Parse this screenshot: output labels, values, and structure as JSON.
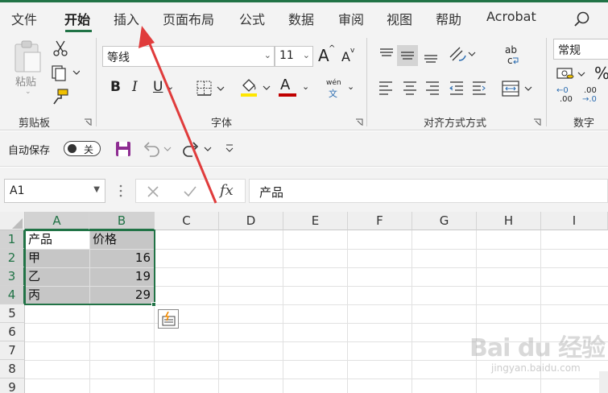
{
  "tabs": [
    {
      "label": "文件"
    },
    {
      "label": "开始",
      "active": true
    },
    {
      "label": "插入"
    },
    {
      "label": "页面布局"
    },
    {
      "label": "公式"
    },
    {
      "label": "数据"
    },
    {
      "label": "审阅"
    },
    {
      "label": "视图"
    },
    {
      "label": "帮助"
    },
    {
      "label": "Acrobat"
    }
  ],
  "ribbon": {
    "clipboard": {
      "paste_label": "粘贴",
      "group_label": "剪贴板"
    },
    "font": {
      "font_name": "等线",
      "font_size": "11",
      "group_label": "字体",
      "bold": "B",
      "italic": "I",
      "underline": "U",
      "phonetic_top": "wén",
      "phonetic_bottom": "文",
      "font_color": "A",
      "grow": "A",
      "shrink": "A"
    },
    "alignment": {
      "group_label": "对齐方式方式",
      "wrap_top": "ab",
      "wrap_bottom": "c"
    },
    "number": {
      "format": "常规",
      "group_label": "数字",
      "percent": "%",
      "inc_decimal_top": "←0",
      "inc_decimal_bottom": ".00",
      "dec_decimal_top": ".00",
      "dec_decimal_bottom": "→.0"
    }
  },
  "qat": {
    "autosave_label": "自动保存",
    "toggle_state": "关"
  },
  "formula_bar": {
    "name_box": "A1",
    "formula": "产品",
    "fx": "fx"
  },
  "sheet": {
    "columns": [
      "A",
      "B",
      "C",
      "D",
      "E",
      "F",
      "G",
      "H",
      "I"
    ],
    "rows": [
      "1",
      "2",
      "3",
      "4",
      "5",
      "6",
      "7",
      "8",
      "9"
    ],
    "cells": [
      [
        "产品",
        "价格"
      ],
      [
        "甲",
        "16"
      ],
      [
        "乙",
        "19"
      ],
      [
        "丙",
        "29"
      ]
    ]
  },
  "watermark": {
    "brand": "Bai du 经验",
    "url": "jingyan.baidu.com"
  },
  "colors": {
    "accent": "#217346",
    "arrow": "#e03c3c",
    "font_color_bar": "#c00000",
    "highlight_bar": "#ffe600"
  }
}
